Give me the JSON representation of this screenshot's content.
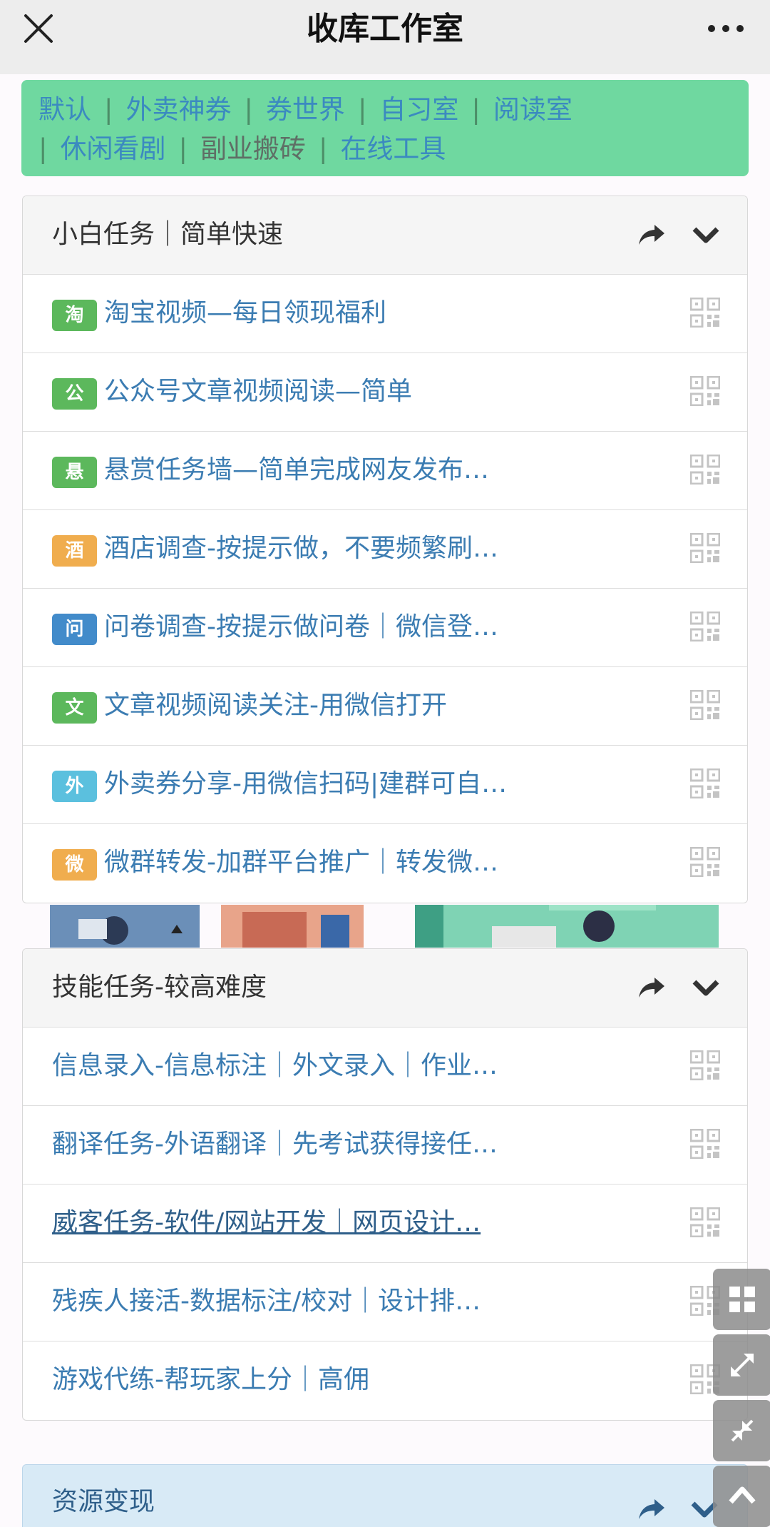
{
  "header": {
    "title": "收库工作室"
  },
  "nav": {
    "items": [
      {
        "label": "默认"
      },
      {
        "label": "外卖神券"
      },
      {
        "label": "券世界"
      },
      {
        "label": "自习室"
      },
      {
        "label": "阅读室"
      },
      {
        "label": "休闲看剧"
      },
      {
        "label": "副业搬砖"
      },
      {
        "label": "在线工具"
      }
    ],
    "separator": "|"
  },
  "panels": [
    {
      "title": "小白任务｜简单快速",
      "items": [
        {
          "badge": "淘",
          "label": "淘宝视频—每日领现福利"
        },
        {
          "badge": "公",
          "label": "公众号文章视频阅读—简单"
        },
        {
          "badge": "悬",
          "label": "悬赏任务墙—简单完成网友发布…"
        },
        {
          "badge": "酒",
          "label": "酒店调查-按提示做，不要频繁刷…"
        },
        {
          "badge": "问",
          "label": "问卷调查-按提示做问卷｜微信登…"
        },
        {
          "badge": "文",
          "label": "文章视频阅读关注-用微信打开"
        },
        {
          "badge": "外",
          "label": "外卖券分享-用微信扫码|建群可自…"
        },
        {
          "badge": "微",
          "label": "微群转发-加群平台推广｜转发微…"
        }
      ]
    },
    {
      "title": "技能任务-较高难度",
      "items": [
        {
          "label": "信息录入-信息标注｜外文录入｜作业…"
        },
        {
          "label": "翻译任务-外语翻译｜先考试获得接任…"
        },
        {
          "label": "威客任务-软件/网站开发｜网页设计…"
        },
        {
          "label": "残疾人接活-数据标注/校对｜设计排…"
        },
        {
          "label": "游戏代练-帮玩家上分｜高佣"
        }
      ]
    },
    {
      "title": "资源变现"
    }
  ],
  "colors": {
    "nav_bg": "#6fd8a0",
    "badge_green": "#5cb85c",
    "badge_orange": "#f0ad4e",
    "badge_blue": "#428bca",
    "badge_cyan": "#5bc0de",
    "link": "#3b7cb2"
  },
  "icons": [
    "close-icon",
    "more-icon",
    "share-icon",
    "chevron-down-icon",
    "qrcode-icon",
    "grid-icon",
    "expand-icon",
    "compress-icon",
    "arrow-up-icon"
  ]
}
